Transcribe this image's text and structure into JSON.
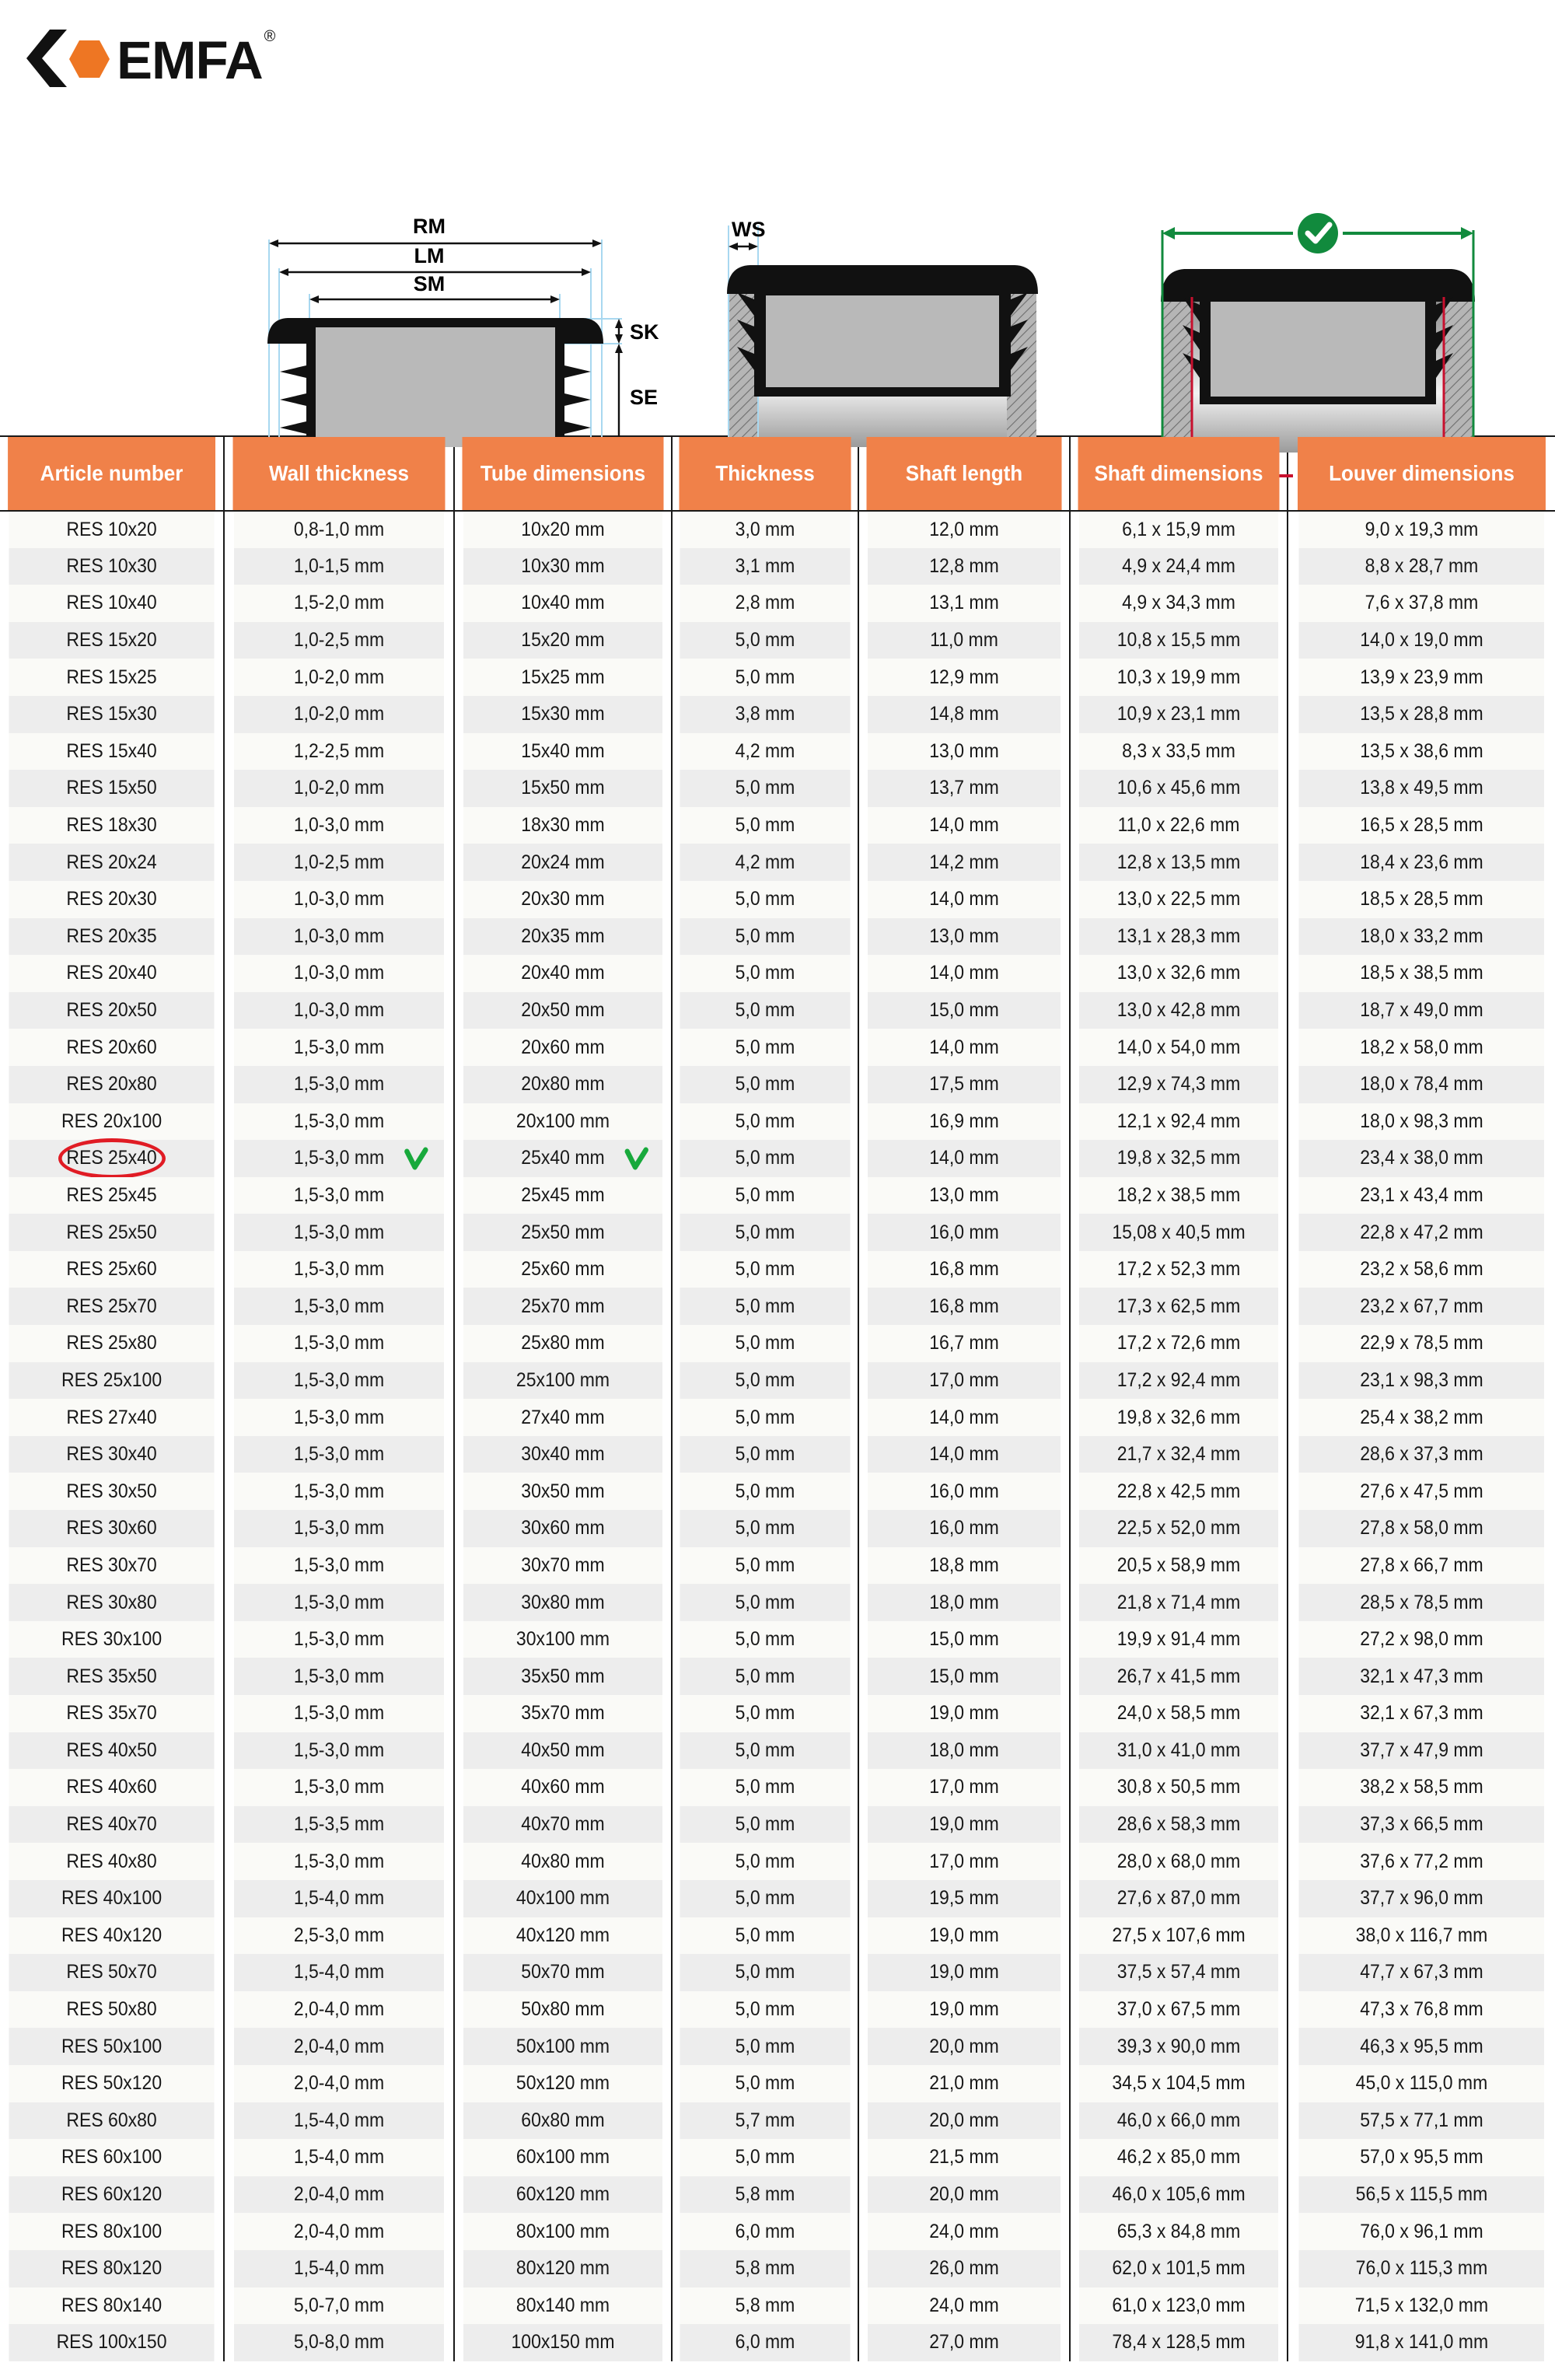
{
  "brand": {
    "name": "EMFA",
    "registered_mark": "®",
    "logo_hex_color": "#EE7623",
    "logo_chevron_color": "#111111"
  },
  "diagrams": {
    "diagram_1": {
      "name": "cap-cross-section",
      "labels": [
        "RM",
        "LM",
        "SM",
        "SK",
        "SE"
      ]
    },
    "diagram_2": {
      "name": "cap-in-tube-wall-thickness",
      "labels": [
        "WS"
      ]
    },
    "diagram_3": {
      "name": "correct-vs-incorrect-measurement",
      "correct_icon": "check-circle-icon",
      "incorrect_icon": "cross-circle-icon",
      "correct_color": "#118A3D",
      "incorrect_color": "#C8102E"
    }
  },
  "table": {
    "header_bg": "#F08149",
    "columns": [
      "Article number",
      "Wall thickness",
      "Tube dimensions",
      "Thickness",
      "Shaft length",
      "Shaft dimensions",
      "Louver dimensions"
    ],
    "highlight": {
      "article": "RES 25x40",
      "oval_color": "#E01B24",
      "check_color": "#18A93C"
    },
    "rows": [
      [
        "RES 10x20",
        "0,8-1,0 mm",
        "10x20 mm",
        "3,0 mm",
        "12,0 mm",
        "6,1 x 15,9 mm",
        "9,0 x 19,3 mm"
      ],
      [
        "RES 10x30",
        "1,0-1,5 mm",
        "10x30 mm",
        "3,1 mm",
        "12,8 mm",
        "4,9 x 24,4 mm",
        "8,8 x 28,7 mm"
      ],
      [
        "RES 10x40",
        "1,5-2,0 mm",
        "10x40 mm",
        "2,8 mm",
        "13,1 mm",
        "4,9 x 34,3 mm",
        "7,6 x 37,8 mm"
      ],
      [
        "RES 15x20",
        "1,0-2,5 mm",
        "15x20 mm",
        "5,0 mm",
        "11,0 mm",
        "10,8 x 15,5 mm",
        "14,0 x 19,0 mm"
      ],
      [
        "RES 15x25",
        "1,0-2,0 mm",
        "15x25 mm",
        "5,0 mm",
        "12,9 mm",
        "10,3 x 19,9 mm",
        "13,9 x 23,9 mm"
      ],
      [
        "RES 15x30",
        "1,0-2,0 mm",
        "15x30 mm",
        "3,8 mm",
        "14,8 mm",
        "10,9 x 23,1 mm",
        "13,5 x 28,8 mm"
      ],
      [
        "RES 15x40",
        "1,2-2,5 mm",
        "15x40 mm",
        "4,2 mm",
        "13,0 mm",
        "8,3 x 33,5 mm",
        "13,5 x 38,6 mm"
      ],
      [
        "RES 15x50",
        "1,0-2,0 mm",
        "15x50 mm",
        "5,0 mm",
        "13,7 mm",
        "10,6 x 45,6 mm",
        "13,8 x 49,5 mm"
      ],
      [
        "RES 18x30",
        "1,0-3,0 mm",
        "18x30 mm",
        "5,0 mm",
        "14,0 mm",
        "11,0 x 22,6 mm",
        "16,5 x 28,5 mm"
      ],
      [
        "RES 20x24",
        "1,0-2,5 mm",
        "20x24 mm",
        "4,2 mm",
        "14,2 mm",
        "12,8 x 13,5 mm",
        "18,4 x 23,6 mm"
      ],
      [
        "RES 20x30",
        "1,0-3,0 mm",
        "20x30 mm",
        "5,0 mm",
        "14,0 mm",
        "13,0 x 22,5 mm",
        "18,5 x 28,5 mm"
      ],
      [
        "RES 20x35",
        "1,0-3,0 mm",
        "20x35 mm",
        "5,0 mm",
        "13,0 mm",
        "13,1 x 28,3 mm",
        "18,0 x 33,2 mm"
      ],
      [
        "RES 20x40",
        "1,0-3,0 mm",
        "20x40 mm",
        "5,0 mm",
        "14,0 mm",
        "13,0 x 32,6 mm",
        "18,5 x 38,5 mm"
      ],
      [
        "RES 20x50",
        "1,0-3,0 mm",
        "20x50 mm",
        "5,0 mm",
        "15,0 mm",
        "13,0 x 42,8 mm",
        "18,7 x 49,0 mm"
      ],
      [
        "RES 20x60",
        "1,5-3,0 mm",
        "20x60 mm",
        "5,0 mm",
        "14,0 mm",
        "14,0 x 54,0 mm",
        "18,2 x 58,0 mm"
      ],
      [
        "RES 20x80",
        "1,5-3,0 mm",
        "20x80 mm",
        "5,0 mm",
        "17,5 mm",
        "12,9 x 74,3 mm",
        "18,0 x 78,4 mm"
      ],
      [
        "RES 20x100",
        "1,5-3,0 mm",
        "20x100 mm",
        "5,0 mm",
        "16,9 mm",
        "12,1 x 92,4 mm",
        "18,0 x 98,3 mm"
      ],
      [
        "RES 25x40",
        "1,5-3,0 mm",
        "25x40 mm",
        "5,0 mm",
        "14,0 mm",
        "19,8 x 32,5 mm",
        "23,4 x 38,0 mm"
      ],
      [
        "RES 25x45",
        "1,5-3,0 mm",
        "25x45 mm",
        "5,0 mm",
        "13,0 mm",
        "18,2 x 38,5 mm",
        "23,1 x 43,4 mm"
      ],
      [
        "RES 25x50",
        "1,5-3,0 mm",
        "25x50 mm",
        "5,0 mm",
        "16,0 mm",
        "15,08 x 40,5 mm",
        "22,8 x 47,2 mm"
      ],
      [
        "RES 25x60",
        "1,5-3,0 mm",
        "25x60 mm",
        "5,0 mm",
        "16,8 mm",
        "17,2 x 52,3 mm",
        "23,2 x 58,6 mm"
      ],
      [
        "RES 25x70",
        "1,5-3,0 mm",
        "25x70 mm",
        "5,0 mm",
        "16,8 mm",
        "17,3 x 62,5 mm",
        "23,2 x 67,7 mm"
      ],
      [
        "RES 25x80",
        "1,5-3,0 mm",
        "25x80 mm",
        "5,0 mm",
        "16,7 mm",
        "17,2 x 72,6 mm",
        "22,9 x 78,5 mm"
      ],
      [
        "RES 25x100",
        "1,5-3,0 mm",
        "25x100 mm",
        "5,0 mm",
        "17,0 mm",
        "17,2 x 92,4 mm",
        "23,1 x 98,3 mm"
      ],
      [
        "RES 27x40",
        "1,5-3,0 mm",
        "27x40 mm",
        "5,0 mm",
        "14,0 mm",
        "19,8 x 32,6 mm",
        "25,4 x 38,2 mm"
      ],
      [
        "RES 30x40",
        "1,5-3,0 mm",
        "30x40 mm",
        "5,0 mm",
        "14,0 mm",
        "21,7 x 32,4 mm",
        "28,6 x 37,3 mm"
      ],
      [
        "RES 30x50",
        "1,5-3,0 mm",
        "30x50 mm",
        "5,0 mm",
        "16,0 mm",
        "22,8 x 42,5 mm",
        "27,6 x 47,5 mm"
      ],
      [
        "RES 30x60",
        "1,5-3,0 mm",
        "30x60 mm",
        "5,0 mm",
        "16,0 mm",
        "22,5 x 52,0 mm",
        "27,8 x 58,0 mm"
      ],
      [
        "RES 30x70",
        "1,5-3,0 mm",
        "30x70 mm",
        "5,0 mm",
        "18,8 mm",
        "20,5 x 58,9 mm",
        "27,8 x 66,7 mm"
      ],
      [
        "RES 30x80",
        "1,5-3,0 mm",
        "30x80 mm",
        "5,0 mm",
        "18,0 mm",
        "21,8 x 71,4 mm",
        "28,5 x 78,5 mm"
      ],
      [
        "RES 30x100",
        "1,5-3,0 mm",
        "30x100 mm",
        "5,0 mm",
        "15,0 mm",
        "19,9 x 91,4 mm",
        "27,2 x 98,0 mm"
      ],
      [
        "RES 35x50",
        "1,5-3,0 mm",
        "35x50 mm",
        "5,0 mm",
        "15,0 mm",
        "26,7 x 41,5 mm",
        "32,1 x 47,3 mm"
      ],
      [
        "RES 35x70",
        "1,5-3,0 mm",
        "35x70 mm",
        "5,0 mm",
        "19,0 mm",
        "24,0 x 58,5 mm",
        "32,1 x 67,3 mm"
      ],
      [
        "RES 40x50",
        "1,5-3,0 mm",
        "40x50 mm",
        "5,0 mm",
        "18,0 mm",
        "31,0 x 41,0 mm",
        "37,7 x 47,9 mm"
      ],
      [
        "RES 40x60",
        "1,5-3,0 mm",
        "40x60 mm",
        "5,0 mm",
        "17,0 mm",
        "30,8 x 50,5 mm",
        "38,2 x 58,5 mm"
      ],
      [
        "RES 40x70",
        "1,5-3,5 mm",
        "40x70 mm",
        "5,0 mm",
        "19,0 mm",
        "28,6 x 58,3 mm",
        "37,3 x 66,5 mm"
      ],
      [
        "RES 40x80",
        "1,5-3,0 mm",
        "40x80 mm",
        "5,0 mm",
        "17,0 mm",
        "28,0 x 68,0 mm",
        "37,6 x 77,2 mm"
      ],
      [
        "RES 40x100",
        "1,5-4,0 mm",
        "40x100 mm",
        "5,0 mm",
        "19,5 mm",
        "27,6 x 87,0 mm",
        "37,7 x 96,0 mm"
      ],
      [
        "RES 40x120",
        "2,5-3,0 mm",
        "40x120 mm",
        "5,0 mm",
        "19,0 mm",
        "27,5 x 107,6 mm",
        "38,0 x 116,7 mm"
      ],
      [
        "RES 50x70",
        "1,5-4,0 mm",
        "50x70 mm",
        "5,0 mm",
        "19,0 mm",
        "37,5 x 57,4 mm",
        "47,7 x 67,3 mm"
      ],
      [
        "RES 50x80",
        "2,0-4,0 mm",
        "50x80 mm",
        "5,0 mm",
        "19,0 mm",
        "37,0 x 67,5 mm",
        "47,3 x 76,8 mm"
      ],
      [
        "RES 50x100",
        "2,0-4,0 mm",
        "50x100 mm",
        "5,0 mm",
        "20,0 mm",
        "39,3 x 90,0 mm",
        "46,3 x 95,5 mm"
      ],
      [
        "RES 50x120",
        "2,0-4,0 mm",
        "50x120 mm",
        "5,0 mm",
        "21,0 mm",
        "34,5 x 104,5 mm",
        "45,0 x 115,0 mm"
      ],
      [
        "RES 60x80",
        "1,5-4,0 mm",
        "60x80 mm",
        "5,7 mm",
        "20,0 mm",
        "46,0 x 66,0 mm",
        "57,5 x 77,1 mm"
      ],
      [
        "RES 60x100",
        "1,5-4,0 mm",
        "60x100 mm",
        "5,0 mm",
        "21,5 mm",
        "46,2 x 85,0 mm",
        "57,0 x 95,5 mm"
      ],
      [
        "RES 60x120",
        "2,0-4,0 mm",
        "60x120 mm",
        "5,8 mm",
        "20,0 mm",
        "46,0 x 105,6 mm",
        "56,5 x 115,5 mm"
      ],
      [
        "RES 80x100",
        "2,0-4,0 mm",
        "80x100 mm",
        "6,0 mm",
        "24,0 mm",
        "65,3 x 84,8 mm",
        "76,0 x 96,1 mm"
      ],
      [
        "RES 80x120",
        "1,5-4,0 mm",
        "80x120 mm",
        "5,8 mm",
        "26,0 mm",
        "62,0 x 101,5 mm",
        "76,0 x 115,3 mm"
      ],
      [
        "RES 80x140",
        "5,0-7,0 mm",
        "80x140 mm",
        "5,8 mm",
        "24,0 mm",
        "61,0 x 123,0 mm",
        "71,5 x 132,0 mm"
      ],
      [
        "RES 100x150",
        "5,0-8,0 mm",
        "100x150 mm",
        "6,0 mm",
        "27,0 mm",
        "78,4 x 128,5 mm",
        "91,8 x 141,0 mm"
      ]
    ]
  }
}
